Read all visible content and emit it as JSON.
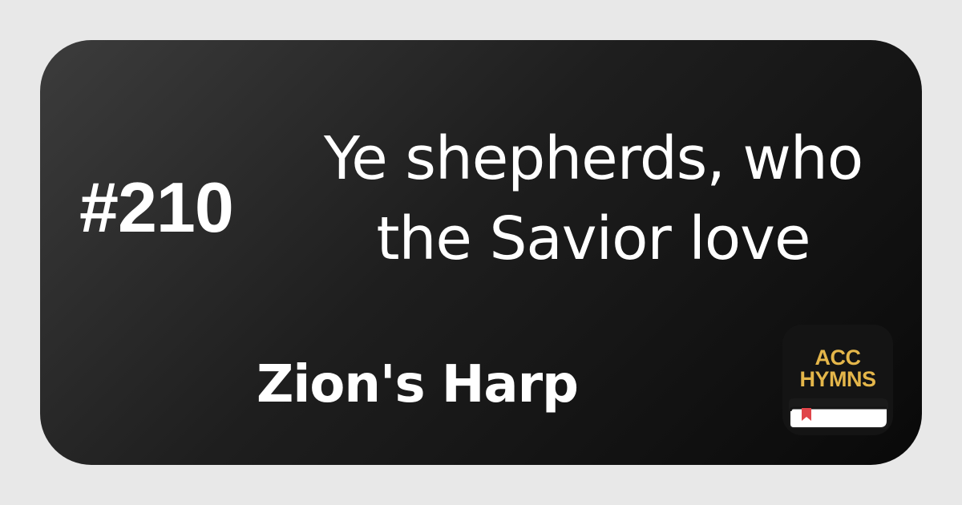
{
  "hymn": {
    "number": "#210",
    "title_line_1": "Ye shepherds, who",
    "title_line_2": "the Savior love",
    "book": "Zion's Harp"
  },
  "app_icon": {
    "line_1": "ACC",
    "line_2": "HYMNS",
    "text_color": "#e4b64a",
    "bookmark_color": "#e0454a"
  },
  "colors": {
    "background": "#e8e8e8",
    "card_gradient_start": "#3c3c3c",
    "card_gradient_end": "#090909",
    "text": "#ffffff"
  }
}
